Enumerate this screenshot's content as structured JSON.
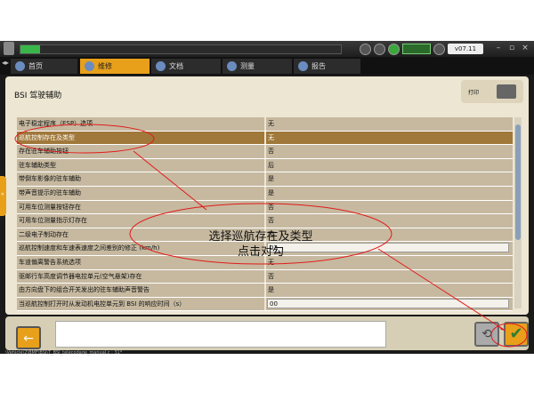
{
  "topbar": {
    "version": "v07.11"
  },
  "tabs": [
    {
      "label": "首页"
    },
    {
      "label": "维修"
    },
    {
      "label": "文档"
    },
    {
      "label": "测量"
    },
    {
      "label": "报告"
    }
  ],
  "panel": {
    "title": "BSI 驾驶辅助",
    "print_label": "打印"
  },
  "rows": [
    {
      "label": "电子稳定程序（ESP）选项",
      "value": "无"
    },
    {
      "label": "巡航控制存在及类型",
      "value": "无"
    },
    {
      "label": "存在驻车辅助按钮",
      "value": "否"
    },
    {
      "label": "驻车辅助类型",
      "value": "后"
    },
    {
      "label": "带倒车影像的驻车辅助",
      "value": "是"
    },
    {
      "label": "带声音提示的驻车辅助",
      "value": "是"
    },
    {
      "label": "可用车位测量按钮存在",
      "value": "否"
    },
    {
      "label": "可用车位测量指示灯存在",
      "value": "否"
    },
    {
      "label": "二级电子制动存在",
      "value": "否"
    },
    {
      "label": "巡航控制速度和车速表速度之间差别的修正 (km/h)",
      "value": "03"
    },
    {
      "label": "车道偏离警告系统选项",
      "value": "无"
    },
    {
      "label": "驱邮行车高度调节器电控单元(空气悬架)存在",
      "value": "否"
    },
    {
      "label": "由方向盘下的组合开关发出的驻车辅助声音警告",
      "value": "是"
    },
    {
      "label": "当巡航控制打开时从发动机电控单元到 BSI 的响应时间（s）",
      "value": "00"
    }
  ],
  "annotation": {
    "line1": "选择巡航存在及类型",
    "line2": "点击对勾"
  },
  "status": {
    "path": "\\Vehicle\\2\\BMF\\BSI\\T_BSI_telecodage_manual.c : 31*"
  },
  "colors": {
    "accent": "#e8a01a",
    "selected_row": "#a0783a",
    "annotation": "#e21a1a"
  }
}
